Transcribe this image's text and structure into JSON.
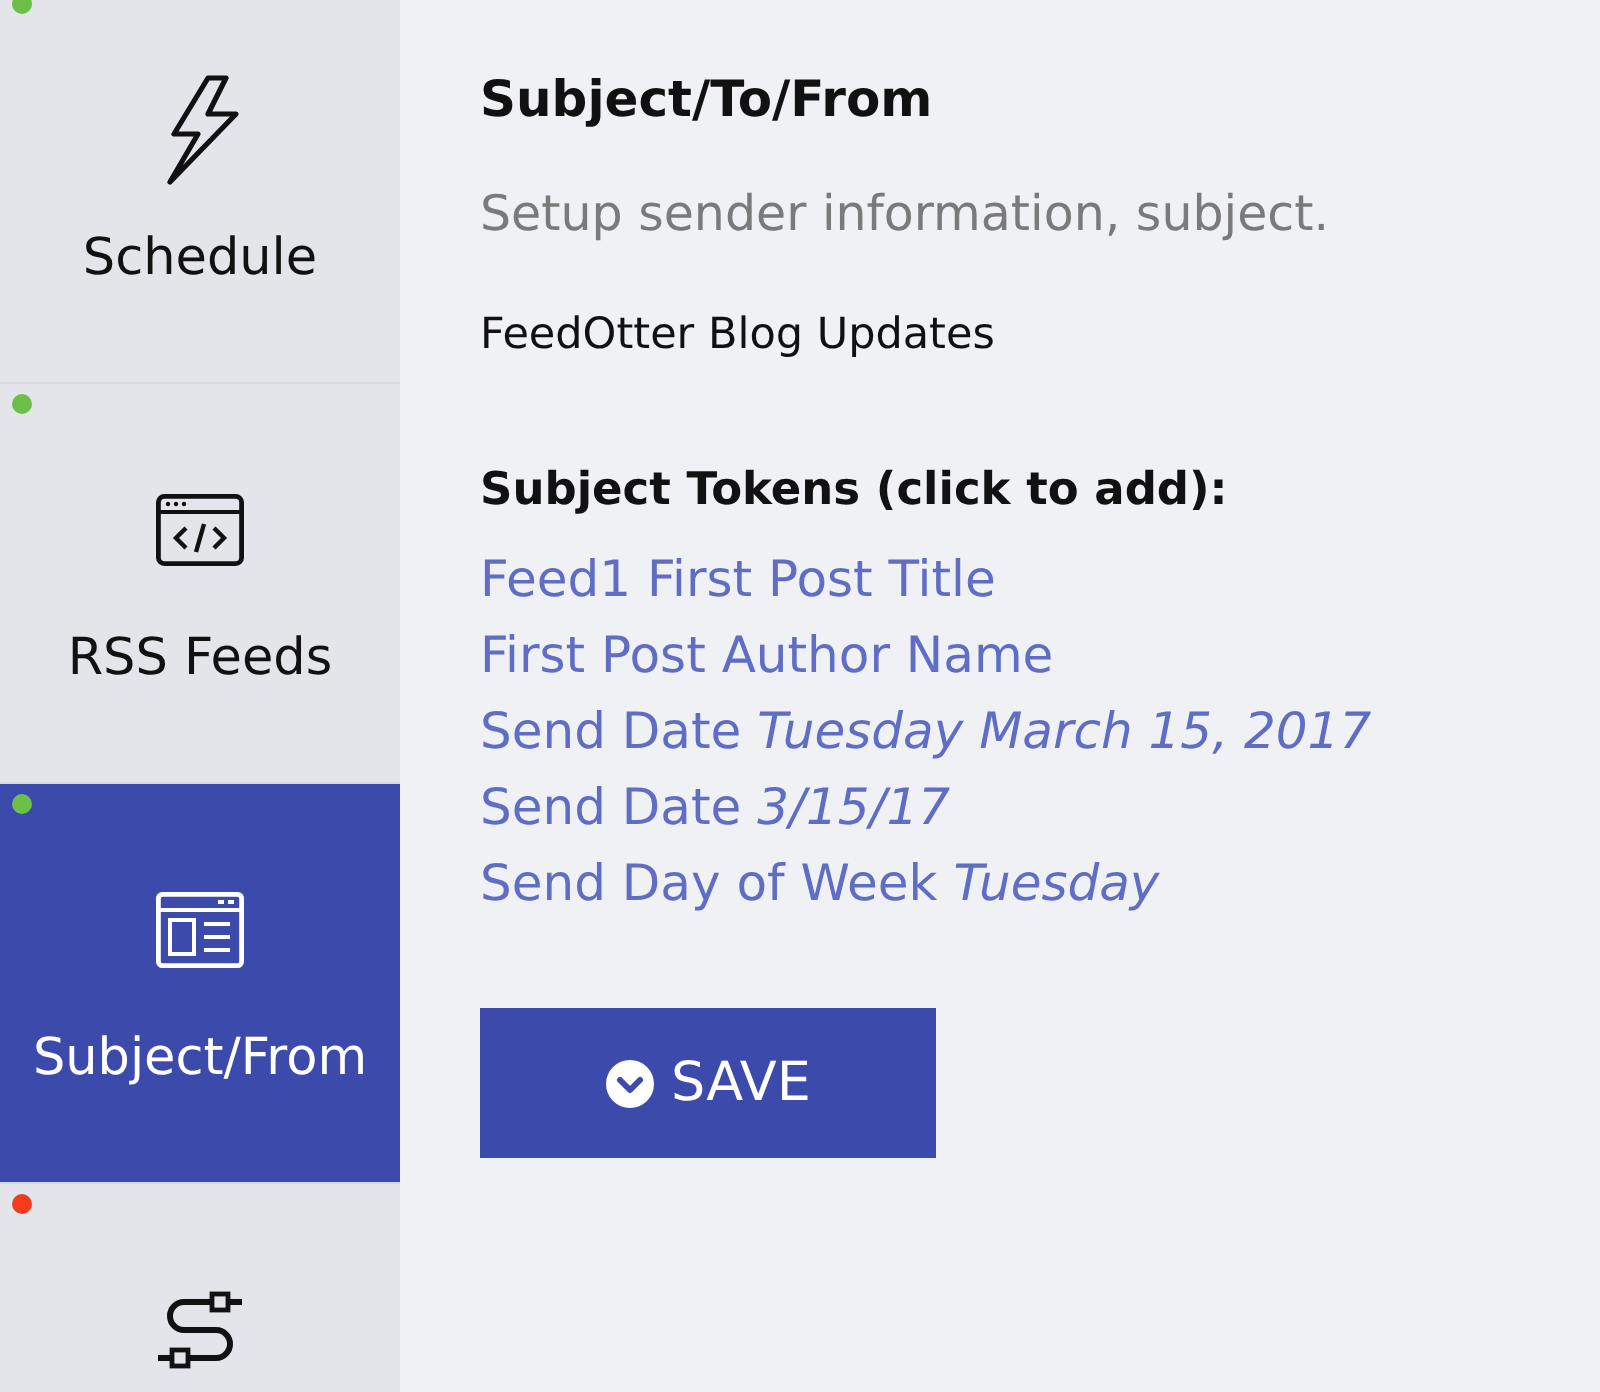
{
  "sidebar": {
    "items": [
      {
        "label": "Schedule",
        "selected": false,
        "color": "#6cc04a"
      },
      {
        "label": "RSS Feeds",
        "selected": false,
        "color": "#6cc04a"
      },
      {
        "label": "Subject/From",
        "selected": true,
        "color": "#6cc04a"
      },
      {
        "selected": false,
        "color": "#f23c1c"
      }
    ]
  },
  "section": {
    "title": "Subject/To/From",
    "description": "Setup sender information, subject.",
    "subject": "FeedOtter Blog Updates",
    "tokens_heading": "Subject Tokens (click to add):",
    "tokens": [
      "Feed1 First Post Title",
      "First Post Author Name",
      "Send Date *Tuesday March 15, 2017*",
      "Send Date *3/15/17*",
      "Send Day of Week *Tuesday*"
    ],
    "save_button": "SAVE"
  }
}
